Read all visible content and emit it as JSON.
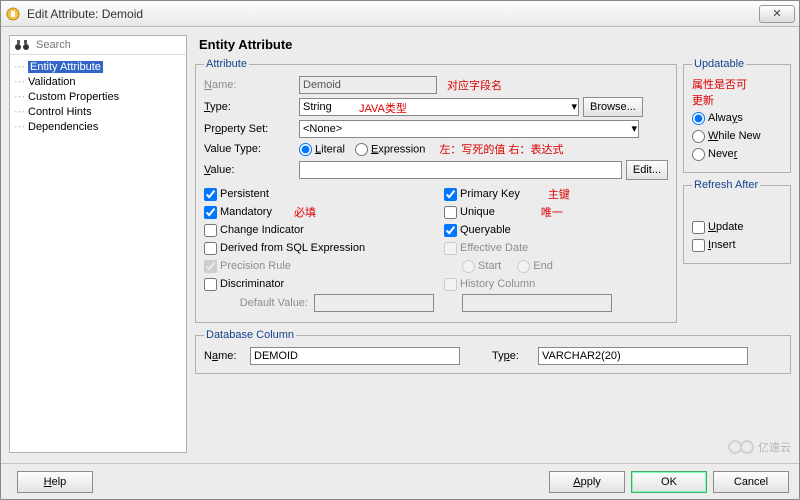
{
  "window": {
    "title": "Edit Attribute: Demoid",
    "close": "✕"
  },
  "search": {
    "placeholder": "Search"
  },
  "tree": {
    "items": [
      "Entity Attribute",
      "Validation",
      "Custom Properties",
      "Control Hints",
      "Dependencies"
    ],
    "selected": 0
  },
  "heading": "Entity Attribute",
  "attribute": {
    "legend": "Attribute",
    "name_label": "Name:",
    "name_value": "Demoid",
    "name_ann": "对应字段名",
    "type_label": "Type:",
    "type_value": "String",
    "type_ann": "JAVA类型",
    "browse": "Browse...",
    "propset_label": "Property Set:",
    "propset_value": "<None>",
    "valtype_label": "Value Type:",
    "literal": "Literal",
    "expression": "Expression",
    "valtype_ann": "左：写死的值 右：表达式",
    "value_label": "Value:",
    "edit": "Edit...",
    "checks": {
      "persistent": "Persistent",
      "mandatory": "Mandatory",
      "mandatory_ann": "必填",
      "change_ind": "Change Indicator",
      "derived": "Derived from SQL Expression",
      "precision": "Precision Rule",
      "discriminator": "Discriminator",
      "default_value": "Default Value:",
      "primary": "Primary Key",
      "primary_ann": "主键",
      "unique": "Unique",
      "unique_ann": "唯一",
      "queryable": "Queryable",
      "effective": "Effective Date",
      "start": "Start",
      "end": "End",
      "history": "History Column"
    }
  },
  "updatable": {
    "legend": "Updatable",
    "ann1": "属性是否可",
    "ann2": "更新",
    "always": "Always",
    "whilenew": "While New",
    "never": "Never"
  },
  "refresh": {
    "legend": "Refresh After",
    "update": "Update",
    "insert": "Insert"
  },
  "db": {
    "legend": "Database Column",
    "name_label": "Name:",
    "name_value": "DEMOID",
    "type_label": "Type:",
    "type_value": "VARCHAR2(20)"
  },
  "footer": {
    "help": "Help",
    "apply": "Apply",
    "ok": "OK",
    "cancel": "Cancel"
  },
  "watermark": "亿速云"
}
